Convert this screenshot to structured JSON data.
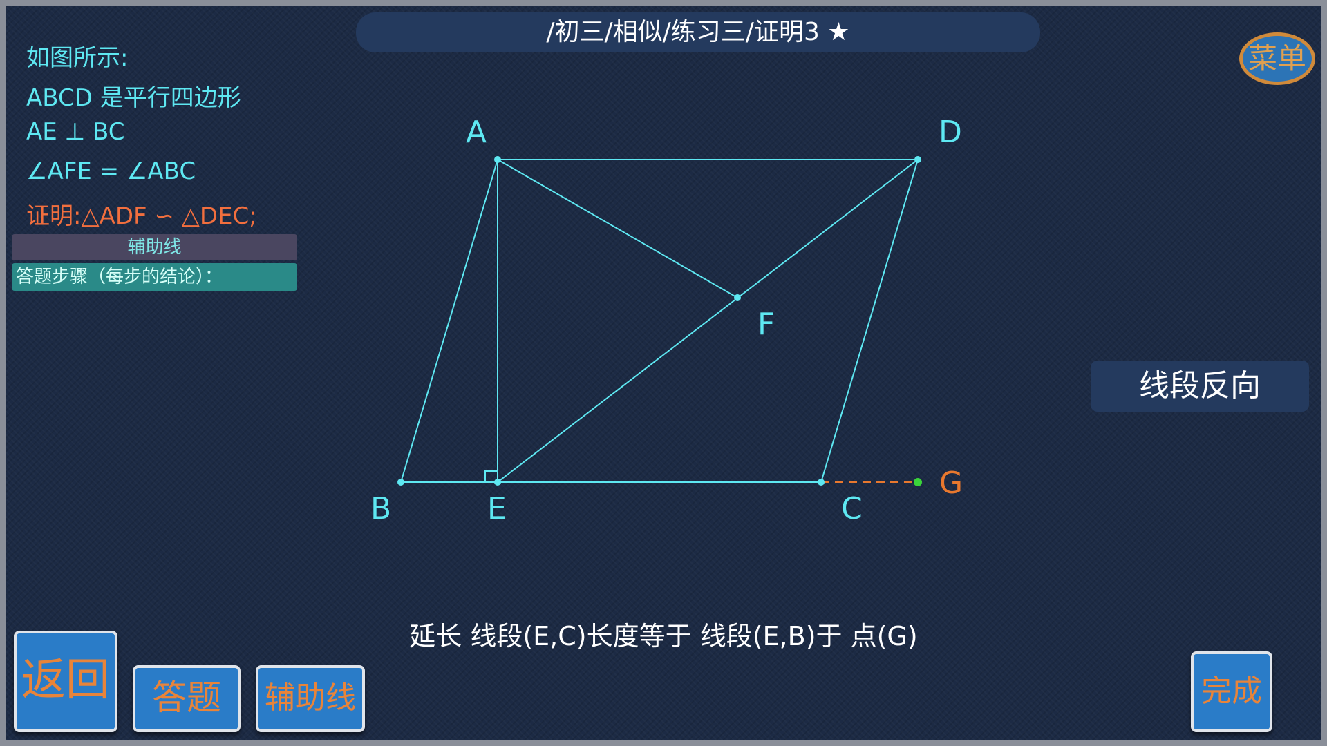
{
  "breadcrumb": "/初三/相似/练习三/证明3 ★",
  "menu_label": "菜单",
  "conditions": [
    "如图所示:",
    "ABCD 是平行四边形",
    "AE ⊥ BC",
    "∠AFE  =  ∠ABC"
  ],
  "goal": "证明:△ADF ∽ △DEC;",
  "aux_bar_label": "辅助线",
  "steps_label": "答题步骤（每步的结论）：",
  "reverse_label": "线段反向",
  "instruction": "延长 线段(E,C)长度等于 线段(E,B)于 点(G)",
  "buttons": {
    "back": "返回",
    "answer": "答题",
    "aux": "辅助线",
    "done": "完成"
  },
  "points": {
    "A": "A",
    "B": "B",
    "C": "C",
    "D": "D",
    "E": "E",
    "F": "F",
    "G": "G"
  },
  "colors": {
    "line": "#5ee8f2",
    "extension": "#e8782e",
    "point_g": "#3ad43a",
    "accent_orange": "#e8843a"
  }
}
